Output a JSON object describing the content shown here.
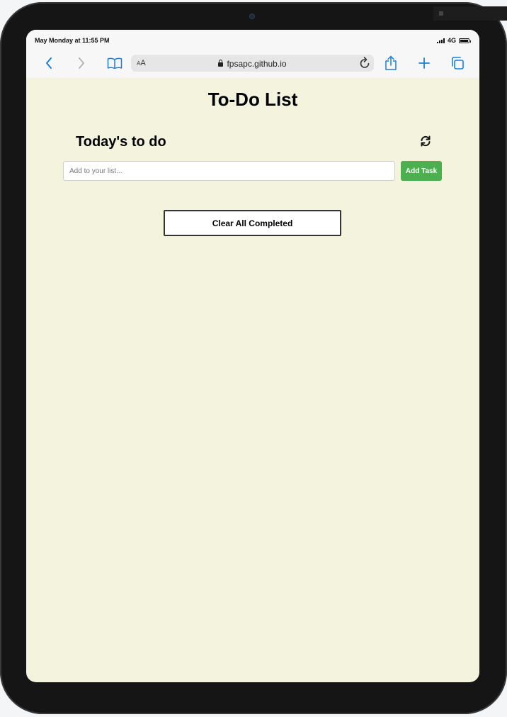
{
  "status_bar": {
    "time": "May Monday at 11:55 PM",
    "network": "4G"
  },
  "browser": {
    "url": "fpsapc.github.io",
    "text_size_label": "AA",
    "icons": {
      "back": "chevron-left-icon",
      "forward": "chevron-right-icon",
      "bookmarks": "book-icon",
      "lock": "lock-icon",
      "reload": "reload-icon",
      "share": "share-icon",
      "new_tab": "plus-icon",
      "tabs": "tabs-icon"
    }
  },
  "app": {
    "title": "To-Do List",
    "list_heading": "Today's to do",
    "input_placeholder": "Add to your list...",
    "input_value": "",
    "add_button_label": "Add Task",
    "clear_button_label": "Clear All Completed",
    "tasks": []
  },
  "colors": {
    "page_background": "#f4f4de",
    "accent": "#4caf50",
    "browser_tint": "#1a7fd4"
  }
}
